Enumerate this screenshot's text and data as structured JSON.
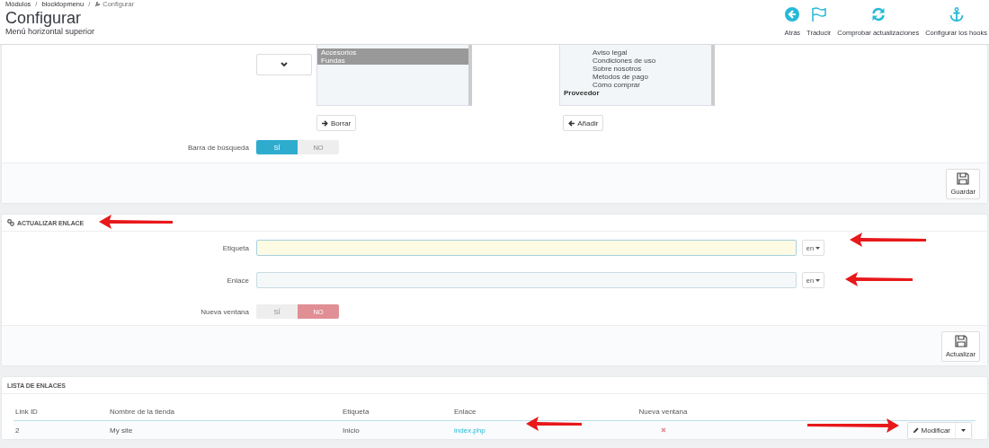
{
  "breadcrumb": [
    {
      "kind": "link",
      "label": "Módulos"
    },
    {
      "kind": "separator",
      "label": "/"
    },
    {
      "kind": "link",
      "label": "blocktopmenu"
    },
    {
      "kind": "separator",
      "label": "/"
    },
    {
      "kind": "current",
      "label": "Configurar"
    }
  ],
  "page_title": "Configurar",
  "page_subtitle": "Menú horizontal superior",
  "toolbar": [
    {
      "label": "Atrás"
    },
    {
      "label": "Traducir"
    },
    {
      "label": "Comprobar actualizaciones"
    },
    {
      "label": "Configurar los hooks"
    }
  ],
  "menu_panel": {
    "selected_list": [
      {
        "label": "Accesorios",
        "selected": true
      },
      {
        "label": "Fundas",
        "selected": true
      }
    ],
    "available_list": [
      {
        "kind": "option",
        "label": "Aviso legal",
        "selected": false
      },
      {
        "kind": "option",
        "label": "Condiciones de uso",
        "selected": false
      },
      {
        "kind": "option",
        "label": "Sobre nosotros",
        "selected": false
      },
      {
        "kind": "option",
        "label": "Metodos de pago",
        "selected": false
      },
      {
        "kind": "option",
        "label": "Cómo comprar",
        "selected": false
      },
      {
        "kind": "group",
        "label": "Proveedor",
        "selected": false
      }
    ],
    "remove_button": "Borrar",
    "add_button": "Añadir",
    "search_bar": {
      "label": "Barra de búsqueda",
      "options": [
        {
          "kind": "yes",
          "label": "SÍ",
          "selected": true
        },
        {
          "kind": "no",
          "label": "NO",
          "selected": false
        }
      ]
    },
    "save_button": "Guardar"
  },
  "link_panel": {
    "title": "ACTUALIZAR ENLACE",
    "fields": [
      {
        "label": "Etiqueta",
        "focused": true,
        "language": "en"
      },
      {
        "label": "Enlace",
        "focused": false,
        "language": "en"
      }
    ],
    "new_window": {
      "label": "Nueva ventana",
      "options": [
        {
          "kind": "yes",
          "label": "SÍ",
          "selected": false
        },
        {
          "kind": "no",
          "label": "NO",
          "selected": true
        }
      ]
    },
    "update_button": "Actualizar"
  },
  "links_table": {
    "title": "LISTA DE ENLACES",
    "columns": [
      "Link ID",
      "Nombre de la tienda",
      "Etiqueta",
      "Enlace",
      "Nueva ventana"
    ],
    "rows": [
      {
        "link_id": "2",
        "shop": "My site",
        "label": "Inicio",
        "link": "index.php",
        "new_window": false,
        "action": "Modificar"
      }
    ]
  }
}
